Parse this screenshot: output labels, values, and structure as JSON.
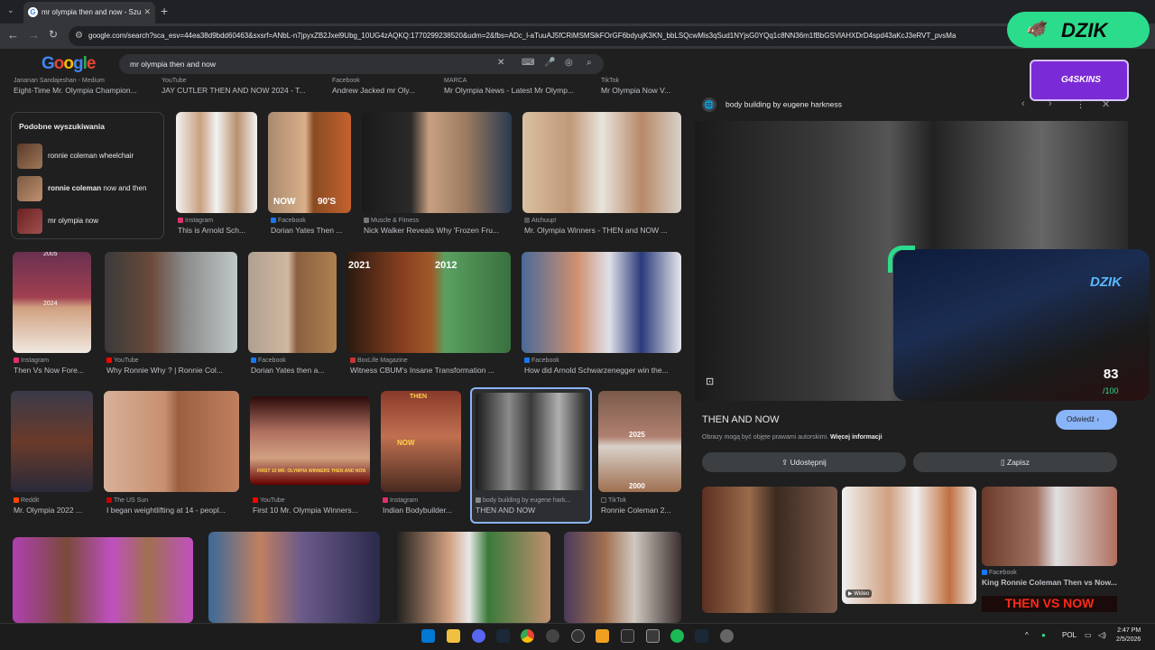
{
  "browser": {
    "tab_title": "mr olympia then and now - Szu",
    "url": "google.com/search?sca_esv=44ea38d9bdd60463&sxsrf=ANbL-n7jpyxZB2Jxel9Ubg_10UG4zAQKQ:1770299238520&udm=2&fbs=ADc_l-aTuuAJ5fCRiMSMSikFOrGF6bdyujK3KN_bbLSQcwMis3qSud1NYjsG0YQq1c8NN36m1fBbGSVlAHXDrD4spd43aKcJ3eRVT_pvsMa"
  },
  "google": {
    "logo": "Google",
    "query": "mr olympia then and now"
  },
  "top_sources": [
    {
      "source": "Jananan Sandajeshan - Medium",
      "title": "Eight-Time Mr. Olympia Champion..."
    },
    {
      "source": "YouTube",
      "title": "JAY CUTLER THEN AND NOW 2024 - T..."
    },
    {
      "source": "Facebook",
      "title": "Andrew Jacked mr Oly..."
    },
    {
      "source": "MARCA",
      "title": "Mr Olympia News - Latest Mr Olymp..."
    },
    {
      "source": "TikTok",
      "title": "Mr Olympia Now V..."
    }
  ],
  "related": {
    "heading": "Podobne wyszukiwania",
    "items": [
      {
        "label": "ronnie coleman wheelchair"
      },
      {
        "label_bold": "ronnie coleman",
        "label": " now and then"
      },
      {
        "label": "mr olympia now"
      }
    ]
  },
  "row1": [
    {
      "source": "Instagram",
      "title": "This is Arnold Sch..."
    },
    {
      "source": "Facebook",
      "title": "Dorian Yates Then ..."
    },
    {
      "source": "Muscle & Fitness",
      "title": "Nick Walker Reveals Why 'Frozen Fru..."
    },
    {
      "source": "Atchuup!",
      "title": "Mr. Olympia Winners - THEN and NOW ..."
    }
  ],
  "row1_overlays": {
    "now": "NOW",
    "nineties": "90'S"
  },
  "row2": [
    {
      "source": "Instagram",
      "title": "Then Vs Now Fore..."
    },
    {
      "source": "YouTube",
      "title": "Why Ronnie Why ? | Ronnie Col..."
    },
    {
      "source": "Facebook",
      "title": "Dorian Yates then a..."
    },
    {
      "source": "BoxLife Magazine",
      "title": "Witness CBUM's Insane Transformation ..."
    },
    {
      "source": "Facebook",
      "title": "How did Arnold Schwarzenegger win the..."
    }
  ],
  "row2_overlays": {
    "y2005": "2005",
    "y2024": "2024",
    "y2021": "2021",
    "y2012": "2012"
  },
  "row3": [
    {
      "source": "Reddit",
      "title": "Mr. Olympia 2022 ..."
    },
    {
      "source": "The US Sun",
      "title": "I began weightlifting at 14 - peopl..."
    },
    {
      "source": "YouTube",
      "title": "First 10 Mr. Olympia Winners..."
    },
    {
      "source": "Instagram",
      "title": "Indian Bodybuilder..."
    },
    {
      "source": "body building by eugene hark...",
      "title": "THEN AND NOW"
    },
    {
      "source": "TikTok",
      "title": "Ronnie Coleman 2..."
    }
  ],
  "row3_overlays": {
    "first10": "FIRST 10 MR. OLYMPIA WINNERS THEN AND NOW",
    "then": "THEN",
    "now": "NOW",
    "y2025": "2025",
    "y2000": "2000"
  },
  "panel": {
    "site": "body building by eugene harkness",
    "title": "THEN AND NOW",
    "copyright": "Obrazy mogą być objęte prawami autorskimi.",
    "more_info": "Więcej informacji",
    "visit": "Odwiedź",
    "share": "Udostępnij",
    "save": "Zapisz",
    "related": [
      {
        "source": "",
        "title": ""
      },
      {
        "source": "",
        "title": "",
        "video": "Wideo"
      },
      {
        "source": "Facebook",
        "title": "King Ronnie Coleman Then vs Now...",
        "overlay": "THEN VS NOW"
      }
    ]
  },
  "overlay": {
    "dzik": "DZIK",
    "g4skins": "G4SKINS",
    "webcam_logo": "DZIK",
    "score": "83",
    "score_max": "/100"
  },
  "taskbar": {
    "lang": "POL",
    "time": "2:47 PM",
    "date": "2/5/2026"
  },
  "colors": {
    "accent": "#8ab4f8",
    "dzik_green": "#2bdc8c",
    "g4_purple": "#7b2bd6"
  }
}
